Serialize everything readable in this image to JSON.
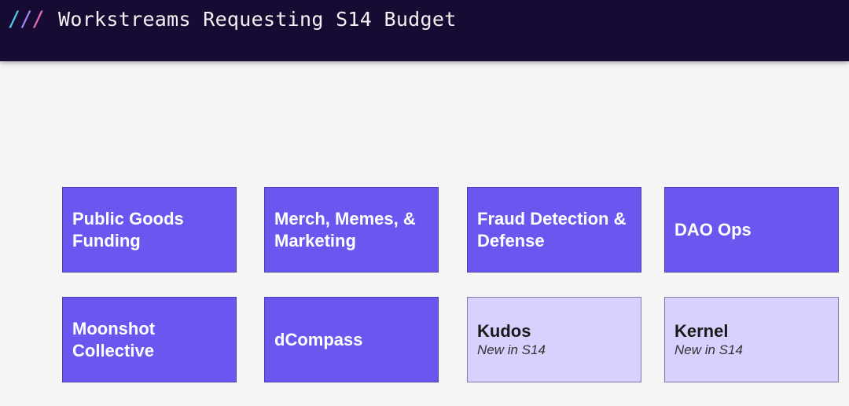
{
  "header": {
    "slashes": [
      "/",
      "/",
      "/"
    ],
    "title": "Workstreams Requesting S14 Budget"
  },
  "workstreams": [
    {
      "label": "Public Goods Funding",
      "note": "",
      "style": "primary"
    },
    {
      "label": "Merch, Memes, & Marketing",
      "note": "",
      "style": "primary"
    },
    {
      "label": "Fraud Detection & Defense",
      "note": "",
      "style": "primary"
    },
    {
      "label": "DAO Ops",
      "note": "",
      "style": "primary"
    },
    {
      "label": "Moonshot Collective",
      "note": "",
      "style": "primary"
    },
    {
      "label": "dCompass",
      "note": "",
      "style": "primary"
    },
    {
      "label": "Kudos",
      "note": "New in S14",
      "style": "light"
    },
    {
      "label": "Kernel",
      "note": "New in S14",
      "style": "light"
    }
  ],
  "colors": {
    "header_bg": "#170b34",
    "card_primary": "#6a57ef",
    "card_new": "#d9d1fd",
    "slash_1": "#56c6e6",
    "slash_2": "#9f86f0",
    "slash_3": "#e56db1"
  }
}
